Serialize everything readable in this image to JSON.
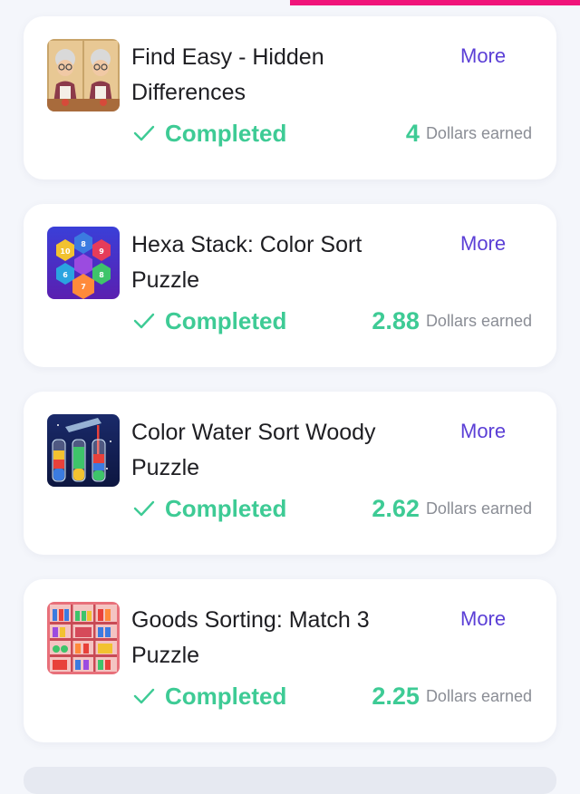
{
  "offers": [
    {
      "title": "Find Easy - Hidden Differences",
      "more_label": "More",
      "status": "Completed",
      "amount": "4",
      "earned_label": "Dollars earned",
      "icon": "find-easy-game-icon"
    },
    {
      "title": "Hexa Stack: Color Sort Puzzle",
      "more_label": "More",
      "status": "Completed",
      "amount": "2.88",
      "earned_label": "Dollars earned",
      "icon": "hexa-stack-game-icon"
    },
    {
      "title": "Color Water Sort Woody Puzzle",
      "more_label": "More",
      "status": "Completed",
      "amount": "2.62",
      "earned_label": "Dollars earned",
      "icon": "water-sort-game-icon"
    },
    {
      "title": "Goods Sorting: Match 3 Puzzle",
      "more_label": "More",
      "status": "Completed",
      "amount": "2.25",
      "earned_label": "Dollars earned",
      "icon": "goods-sorting-game-icon"
    }
  ],
  "colors": {
    "accent": "#f0147a",
    "link": "#5b3fd6",
    "success": "#3ecb95",
    "muted": "#8a8d95"
  }
}
